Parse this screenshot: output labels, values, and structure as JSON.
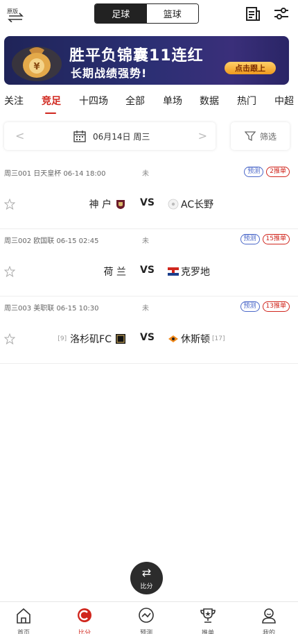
{
  "header": {
    "original_label": "原版",
    "sport_tabs": [
      "足球",
      "篮球"
    ],
    "active_sport": "足球"
  },
  "banner": {
    "line1": "胜平负锦囊11连红",
    "line2": "长期战绩强势!",
    "button": "点击跟上"
  },
  "category_tabs": [
    "关注",
    "竞足",
    "十四场",
    "全部",
    "单场",
    "数据",
    "热门",
    "中超"
  ],
  "active_tab": "竞足",
  "date_bar": {
    "prev": "<",
    "date": "06月14日 周三",
    "next": ">",
    "filter_label": "筛选"
  },
  "matches": [
    {
      "meta": "周三001 日天皇杯 06-14 18:00",
      "status": "未",
      "badge_predict": "预测",
      "badge_push": "2推单",
      "home": "神 户",
      "home_rank": "",
      "vs": "VS",
      "away": "AC长野",
      "away_rank": ""
    },
    {
      "meta": "周三002 欧国联 06-15 02:45",
      "status": "未",
      "badge_predict": "预测",
      "badge_push": "15推单",
      "home": "荷 兰",
      "home_rank": "",
      "vs": "VS",
      "away": "克罗地",
      "away_rank": ""
    },
    {
      "meta": "周三003 美职联 06-15 10:30",
      "status": "未",
      "badge_predict": "预测",
      "badge_push": "13推单",
      "home": "洛杉矶FC",
      "home_rank": "[9]",
      "vs": "VS",
      "away": "休斯顿",
      "away_rank": "[17]"
    }
  ],
  "fab": {
    "label": "比分"
  },
  "bottom_nav": [
    {
      "label": "首页",
      "icon": "home-icon"
    },
    {
      "label": "比分",
      "icon": "score-icon"
    },
    {
      "label": "预测",
      "icon": "trend-icon"
    },
    {
      "label": "推单",
      "icon": "trophy-icon"
    },
    {
      "label": "我的",
      "icon": "user-icon"
    }
  ],
  "active_nav": "比分",
  "colors": {
    "accent": "#d0261d",
    "predict": "#4a67c8",
    "banner": "#2b2f73"
  }
}
